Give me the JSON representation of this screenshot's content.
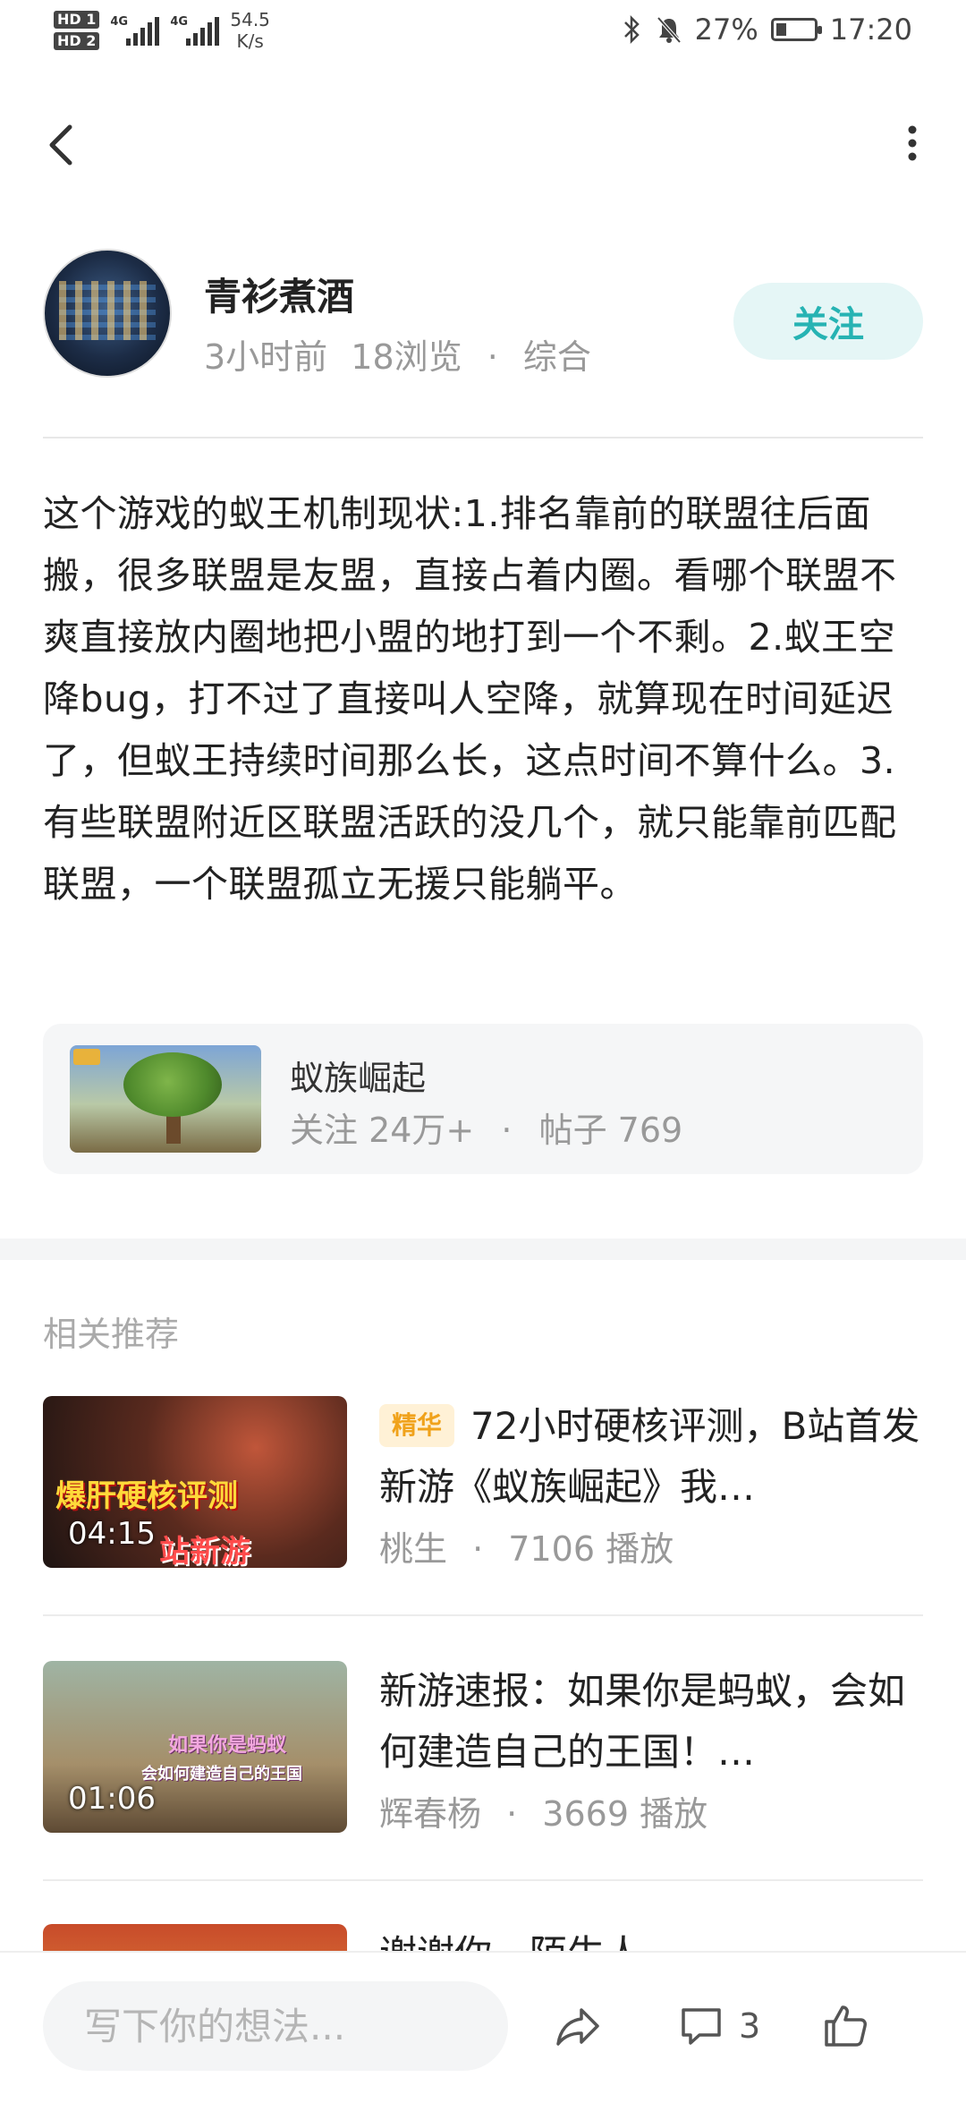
{
  "status_bar": {
    "sim1": "HD 1",
    "sim2": "HD 2",
    "net_type": "4G",
    "speed_value": "54.5",
    "speed_unit": "K/s",
    "battery_percent": "27%",
    "battery_level": 0.27,
    "time": "17:20",
    "icons": [
      "bluetooth-icon",
      "mute-bell-icon",
      "battery-icon"
    ]
  },
  "nav": {
    "back_icon": "chevron-left-icon",
    "more_icon": "vertical-dots-icon"
  },
  "author": {
    "name": "青衫煮酒",
    "time": "3小时前",
    "views": "18浏览",
    "separator": "·",
    "category": "综合",
    "follow_label": "关注"
  },
  "post": {
    "content": "这个游戏的蚁王机制现状:1.排名靠前的联盟往后面搬，很多联盟是友盟，直接占着内圈。看哪个联盟不爽直接放内圈地把小盟的地打到一个不剩。2.蚁王空降bug，打不过了直接叫人空降，就算现在时间延迟了，但蚁王持续时间那么长，这点时间不算什么。3.有些联盟附近区联盟活跃的没几个，就只能靠前匹配联盟，一个联盟孤立无援只能躺平。"
  },
  "forum": {
    "name": "蚁族崛起",
    "followers": "关注 24万+",
    "separator": "·",
    "posts": "帖子 769"
  },
  "related": {
    "heading": "相关推荐",
    "items": [
      {
        "tag": "精华",
        "title": "72小时硬核评测，B站首发新游《蚁族崛起》我…",
        "author": "桃生",
        "separator": "·",
        "plays": "7106 播放",
        "duration": "04:15",
        "thumb_caption_1": "爆肝硬核评测",
        "thumb_caption_2": "站新游"
      },
      {
        "tag": "",
        "title": "新游速报：如果你是蚂蚁，会如何建造自己的王国！…",
        "author": "辉春杨",
        "separator": "·",
        "plays": "3669 播放",
        "duration": "01:06",
        "thumb_caption_1": "如果你是蚂蚁",
        "thumb_caption_2": "会如何建造自己的王国"
      },
      {
        "tag": "",
        "title": "谢谢你，陌生人",
        "author": "",
        "separator": "",
        "plays": "",
        "duration": "",
        "thumb_caption_1": "",
        "thumb_caption_2": ""
      }
    ]
  },
  "bottom_bar": {
    "comment_placeholder": "写下你的想法...",
    "comment_count": "3",
    "share_icon": "share-arrow-icon",
    "comment_icon": "comment-bubble-icon",
    "like_icon": "thumbs-up-icon"
  },
  "colors": {
    "accent": "#26b3b3",
    "follow_bg": "#e5f6f6",
    "tag_text": "#f0a21b",
    "tag_bg": "#fff1d6",
    "meta_text": "#999999"
  }
}
